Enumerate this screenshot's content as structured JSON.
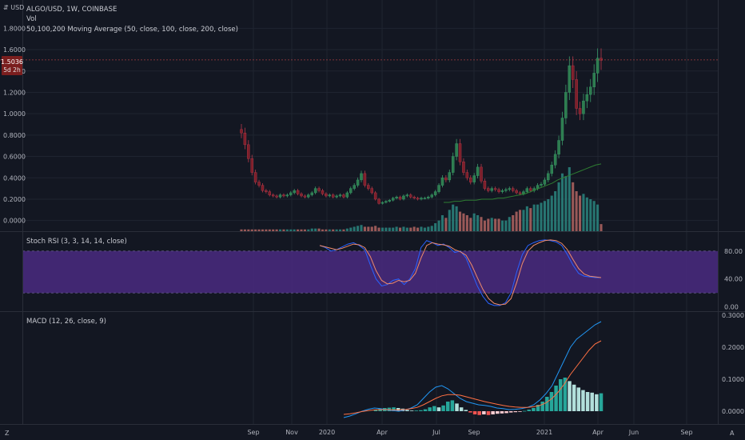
{
  "header": {
    "symbol_title": "ALGO/USD, 1W, COINBASE",
    "indicator_vol": "Vol",
    "indicator_ma": "50,100,200 Moving Average (50, close, 100, close, 200, close)",
    "currency": "USD"
  },
  "price_badge": {
    "price": "1.5036",
    "countdown": "5d 2h"
  },
  "colors": {
    "up": "#26a69a",
    "down": "#ef5350",
    "candle_up": "#2e7d4f",
    "candle_down": "#7d1f2a",
    "ma": "#2e7d32",
    "stoch_k": "#2962ff",
    "stoch_d": "#f08b6a",
    "stoch_band": "#4a2a80",
    "macd": "#2196f3",
    "signal": "#ff7043",
    "background": "#131722",
    "grid": "#1f2430"
  },
  "chart_data": [
    {
      "type": "candlestick",
      "title": "ALGO/USD, 1W, COINBASE",
      "ylim": [
        -0.1,
        1.9
      ],
      "y_ticks": [
        "1.8000",
        "1.6000",
        "1.4000",
        "1.2000",
        "1.0000",
        "0.8000",
        "0.6000",
        "0.4000",
        "0.2000",
        "0.0000"
      ],
      "x_ticks": [
        "Sep",
        "Nov",
        "2020",
        "Apr",
        "Jul",
        "Sep",
        "2021",
        "Apr",
        "Jun",
        "Sep"
      ],
      "closes": [
        0.82,
        0.71,
        0.58,
        0.45,
        0.36,
        0.33,
        0.28,
        0.27,
        0.24,
        0.23,
        0.22,
        0.24,
        0.23,
        0.24,
        0.26,
        0.28,
        0.25,
        0.23,
        0.22,
        0.24,
        0.26,
        0.3,
        0.28,
        0.25,
        0.23,
        0.24,
        0.22,
        0.23,
        0.24,
        0.22,
        0.26,
        0.3,
        0.33,
        0.38,
        0.44,
        0.33,
        0.3,
        0.26,
        0.2,
        0.16,
        0.17,
        0.18,
        0.19,
        0.21,
        0.22,
        0.2,
        0.23,
        0.24,
        0.22,
        0.21,
        0.2,
        0.21,
        0.21,
        0.22,
        0.24,
        0.27,
        0.33,
        0.4,
        0.38,
        0.45,
        0.6,
        0.72,
        0.55,
        0.45,
        0.4,
        0.36,
        0.42,
        0.5,
        0.37,
        0.3,
        0.28,
        0.3,
        0.29,
        0.27,
        0.28,
        0.29,
        0.3,
        0.28,
        0.26,
        0.25,
        0.27,
        0.3,
        0.28,
        0.3,
        0.33,
        0.34,
        0.38,
        0.44,
        0.52,
        0.62,
        0.75,
        0.96,
        1.2,
        1.45,
        1.32,
        1.05,
        1.0,
        1.12,
        1.18,
        1.25,
        1.38,
        1.52,
        1.5
      ],
      "volume_series": [
        0.02,
        0.02,
        0.02,
        0.02,
        0.02,
        0.02,
        0.02,
        0.02,
        0.02,
        0.02,
        0.02,
        0.02,
        0.02,
        0.02,
        0.02,
        0.02,
        0.02,
        0.02,
        0.02,
        0.02,
        0.03,
        0.03,
        0.03,
        0.02,
        0.02,
        0.02,
        0.02,
        0.02,
        0.02,
        0.02,
        0.03,
        0.04,
        0.05,
        0.06,
        0.07,
        0.05,
        0.05,
        0.05,
        0.06,
        0.04,
        0.04,
        0.04,
        0.04,
        0.04,
        0.05,
        0.04,
        0.05,
        0.04,
        0.04,
        0.05,
        0.04,
        0.05,
        0.04,
        0.05,
        0.06,
        0.09,
        0.12,
        0.18,
        0.15,
        0.24,
        0.3,
        0.28,
        0.22,
        0.2,
        0.18,
        0.15,
        0.2,
        0.18,
        0.16,
        0.12,
        0.14,
        0.15,
        0.14,
        0.14,
        0.12,
        0.12,
        0.16,
        0.18,
        0.22,
        0.24,
        0.24,
        0.28,
        0.26,
        0.3,
        0.3,
        0.32,
        0.34,
        0.36,
        0.4,
        0.45,
        0.55,
        0.65,
        0.62,
        0.72,
        0.55,
        0.45,
        0.4,
        0.42,
        0.38,
        0.36,
        0.34,
        0.3,
        0.08
      ],
      "ma_series": [
        0.17,
        0.17,
        0.18,
        0.18,
        0.19,
        0.19,
        0.19,
        0.2,
        0.2,
        0.2,
        0.21,
        0.21,
        0.22,
        0.23,
        0.24,
        0.25,
        0.27,
        0.29,
        0.31,
        0.33,
        0.35,
        0.38,
        0.4,
        0.42,
        0.44,
        0.46,
        0.48,
        0.5,
        0.52,
        0.53
      ]
    },
    {
      "type": "line",
      "title": "Stoch RSI (3, 3, 14, 14, close)",
      "ylim": [
        -5,
        105
      ],
      "y_ticks": [
        "80.00",
        "40.00",
        "0.00"
      ],
      "band": [
        20,
        80
      ],
      "series": [
        {
          "name": "K",
          "values": [
            88,
            85,
            80,
            82,
            86,
            90,
            92,
            88,
            82,
            60,
            40,
            30,
            32,
            38,
            40,
            32,
            40,
            55,
            85,
            95,
            92,
            88,
            90,
            85,
            78,
            80,
            70,
            50,
            30,
            15,
            5,
            2,
            2,
            6,
            20,
            50,
            75,
            88,
            92,
            95,
            96,
            95,
            93,
            88,
            75,
            60,
            48,
            44,
            43,
            42,
            42
          ]
        },
        {
          "name": "D",
          "values": [
            88,
            86,
            84,
            82,
            84,
            87,
            90,
            89,
            85,
            72,
            52,
            38,
            33,
            34,
            38,
            36,
            38,
            48,
            70,
            88,
            92,
            90,
            89,
            87,
            82,
            79,
            74,
            60,
            42,
            25,
            12,
            5,
            3,
            4,
            12,
            35,
            62,
            80,
            88,
            92,
            95,
            96,
            95,
            91,
            82,
            68,
            55,
            47,
            44,
            43,
            42
          ]
        }
      ]
    },
    {
      "type": "bar",
      "title": "MACD (12, 26, close, 9)",
      "ylim": [
        -0.035,
        0.305
      ],
      "y_ticks": [
        "0.3000",
        "0.2000",
        "0.1000",
        "0.0000"
      ],
      "histogram": [
        0.004,
        0.008,
        0.01,
        0.011,
        0.012,
        0.01,
        0.008,
        0.004,
        0.002,
        0.002,
        0.003,
        0.006,
        0.012,
        0.016,
        0.012,
        0.018,
        0.03,
        0.034,
        0.024,
        0.012,
        0.004,
        -0.004,
        -0.01,
        -0.012,
        -0.01,
        -0.012,
        -0.01,
        -0.008,
        -0.007,
        -0.006,
        -0.004,
        -0.003,
        -0.002,
        0.001,
        0.005,
        0.01,
        0.02,
        0.03,
        0.045,
        0.06,
        0.08,
        0.1,
        0.105,
        0.094,
        0.083,
        0.074,
        0.066,
        0.06,
        0.058,
        0.053,
        0.056
      ],
      "series": [
        {
          "name": "MACD",
          "values": [
            -0.02,
            -0.015,
            -0.008,
            0.0,
            0.006,
            0.01,
            0.008,
            0.004,
            0.002,
            0.0,
            0.004,
            0.01,
            0.02,
            0.04,
            0.06,
            0.075,
            0.08,
            0.07,
            0.055,
            0.04,
            0.03,
            0.025,
            0.02,
            0.018,
            0.015,
            0.01,
            0.008,
            0.005,
            0.006,
            0.008,
            0.012,
            0.02,
            0.035,
            0.055,
            0.08,
            0.12,
            0.16,
            0.2,
            0.225,
            0.24,
            0.255,
            0.27,
            0.28
          ]
        },
        {
          "name": "Signal",
          "values": [
            -0.01,
            -0.008,
            -0.005,
            -0.001,
            0.002,
            0.004,
            0.005,
            0.005,
            0.004,
            0.004,
            0.005,
            0.008,
            0.012,
            0.02,
            0.03,
            0.04,
            0.048,
            0.052,
            0.052,
            0.05,
            0.045,
            0.04,
            0.035,
            0.03,
            0.026,
            0.022,
            0.018,
            0.015,
            0.013,
            0.012,
            0.012,
            0.014,
            0.018,
            0.026,
            0.04,
            0.06,
            0.085,
            0.115,
            0.14,
            0.165,
            0.19,
            0.21,
            0.22
          ]
        }
      ]
    }
  ]
}
